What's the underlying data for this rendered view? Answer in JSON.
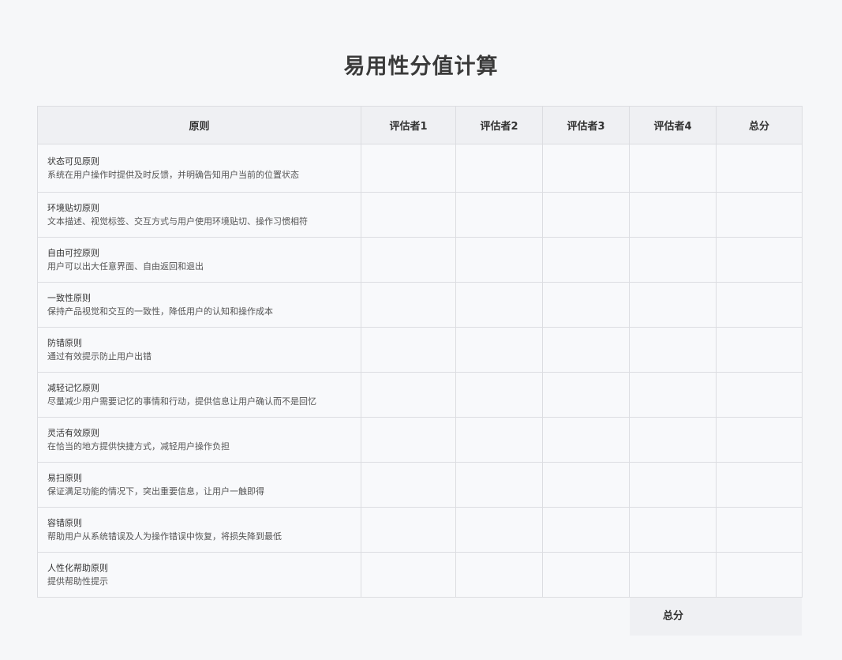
{
  "title": "易用性分值计算",
  "table": {
    "headers": [
      "原则",
      "评估者1",
      "评估者2",
      "评估者3",
      "评估者4",
      "总分"
    ],
    "rows": [
      {
        "name": "状态可见原则",
        "desc": "系统在用户操作时提供及时反馈，并明确告知用户当前的位置状态",
        "scores": [
          "",
          "",
          "",
          "",
          ""
        ]
      },
      {
        "name": "环境贴切原则",
        "desc": "文本描述、视觉标签、交互方式与用户使用环境贴切、操作习惯相符",
        "scores": [
          "",
          "",
          "",
          "",
          ""
        ]
      },
      {
        "name": "自由可控原则",
        "desc": "用户可以出大任意界面、自由返回和退出",
        "scores": [
          "",
          "",
          "",
          "",
          ""
        ]
      },
      {
        "name": "一致性原则",
        "desc": "保持产品视觉和交互的一致性，降低用户的认知和操作成本",
        "scores": [
          "",
          "",
          "",
          "",
          ""
        ]
      },
      {
        "name": "防错原则",
        "desc": "通过有效提示防止用户出错",
        "scores": [
          "",
          "",
          "",
          "",
          ""
        ]
      },
      {
        "name": "减轻记忆原则",
        "desc": "尽量减少用户需要记忆的事情和行动，提供信息让用户确认而不是回忆",
        "scores": [
          "",
          "",
          "",
          "",
          ""
        ]
      },
      {
        "name": "灵活有效原则",
        "desc": "在恰当的地方提供快捷方式，减轻用户操作负担",
        "scores": [
          "",
          "",
          "",
          "",
          ""
        ]
      },
      {
        "name": "易扫原则",
        "desc": "保证满足功能的情况下，突出重要信息，让用户一触即得",
        "scores": [
          "",
          "",
          "",
          "",
          ""
        ]
      },
      {
        "name": "容错原则",
        "desc": "帮助用户从系统错误及人为操作错误中恢复，将损失降到最低",
        "scores": [
          "",
          "",
          "",
          "",
          ""
        ]
      },
      {
        "name": "人性化帮助原则",
        "desc": "提供帮助性提示",
        "scores": [
          "",
          "",
          "",
          "",
          ""
        ]
      }
    ]
  },
  "footer": {
    "total_label": "总分",
    "total_value": ""
  }
}
